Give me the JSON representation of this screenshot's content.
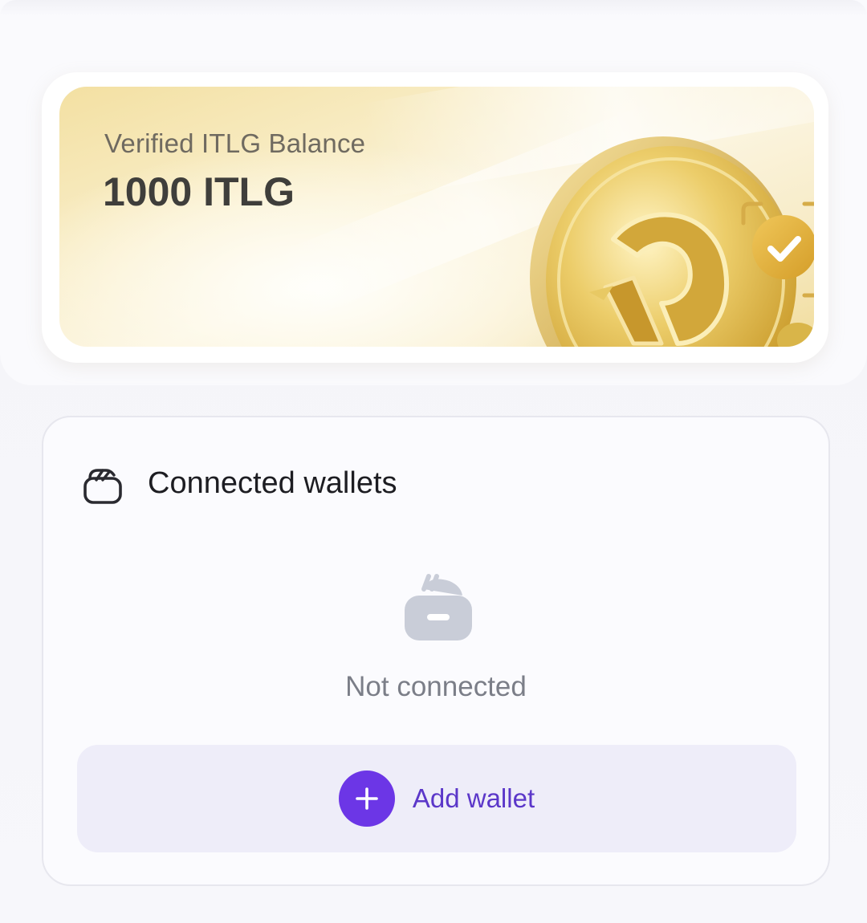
{
  "balance": {
    "label": "Verified ITLG Balance",
    "value": "1000 ITLG",
    "icons": [
      "itlg-coin-icon",
      "verified-check-icon"
    ]
  },
  "wallets": {
    "title": "Connected wallets",
    "title_icon": "wallet-icon",
    "empty_icon": "wallet-empty-icon",
    "empty_text": "Not connected",
    "add_button": {
      "label": "Add wallet",
      "icon": "plus-icon"
    }
  },
  "colors": {
    "accent": "#6c36e6",
    "accent_text": "#5b37c9",
    "button_bg": "#eeedf9",
    "gold": "#e8c55a",
    "muted_icon": "#c9cdd8"
  }
}
